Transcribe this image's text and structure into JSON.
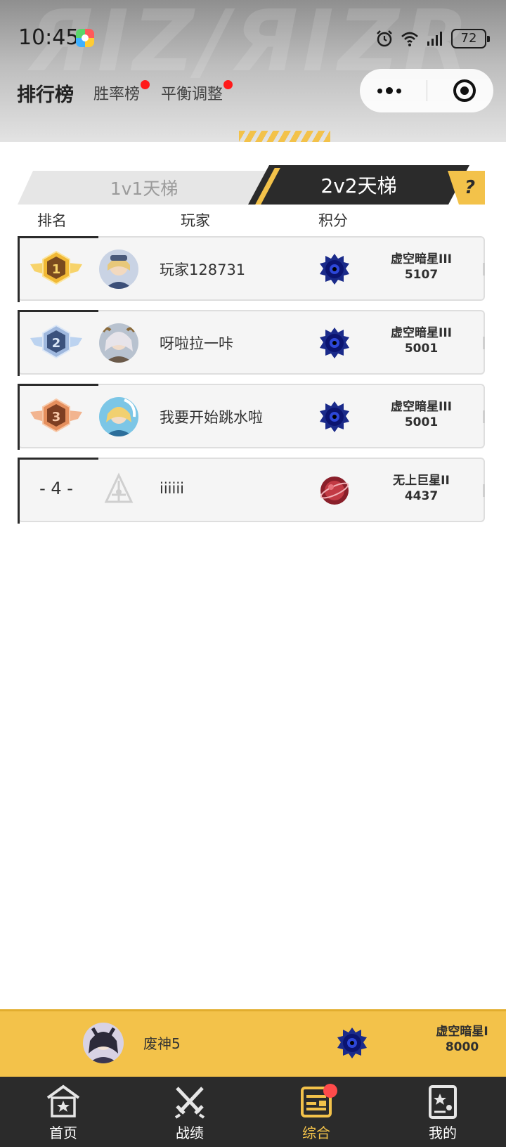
{
  "status_bar": {
    "time": "10:45",
    "battery": "72",
    "icons": [
      "app-logo-icon",
      "alarm-icon",
      "wifi-icon",
      "signal-icon",
      "battery-icon"
    ]
  },
  "header": {
    "title": "排行榜",
    "links": [
      {
        "label": "胜率榜",
        "has_dot": true
      },
      {
        "label": "平衡调整",
        "has_dot": true
      }
    ],
    "capsule_icons": [
      "more-icon",
      "close-target-icon"
    ]
  },
  "tabs": {
    "items": [
      {
        "label": "1v1天梯",
        "active": false
      },
      {
        "label": "2v2天梯",
        "active": true
      }
    ],
    "help_label": "?"
  },
  "columns": {
    "rank": "排名",
    "player": "玩家",
    "score": "积分"
  },
  "rows": [
    {
      "rank": "1",
      "name": "玩家128731",
      "tier": "虚空暗星III",
      "score": "5107",
      "badge": "gold",
      "tier_icon": "void-star-icon"
    },
    {
      "rank": "2",
      "name": "呀啦拉一咔",
      "tier": "虚空暗星III",
      "score": "5001",
      "badge": "silver",
      "tier_icon": "void-star-icon"
    },
    {
      "rank": "3",
      "name": "我要开始跳水啦",
      "tier": "虚空暗星III",
      "score": "5001",
      "badge": "bronze",
      "tier_icon": "void-star-icon"
    },
    {
      "rank": "- 4 -",
      "name": "iiiiii",
      "tier": "无上巨星II",
      "score": "4437",
      "badge": "none",
      "tier_icon": "red-giant-star-icon"
    }
  ],
  "my_rank": {
    "name": "废神5",
    "tier": "虚空暗星I",
    "score": "8000",
    "tier_icon": "void-star-icon"
  },
  "bottom_nav": [
    {
      "label": "首页",
      "icon": "home-icon",
      "active": false
    },
    {
      "label": "战绩",
      "icon": "swords-icon",
      "active": false
    },
    {
      "label": "综合",
      "icon": "overview-icon",
      "active": true,
      "badge": true
    },
    {
      "label": "我的",
      "icon": "profile-card-icon",
      "active": false
    }
  ],
  "colors": {
    "accent": "#f3c24a",
    "dark": "#2b2b2b",
    "dot": "#ff1a1a"
  }
}
